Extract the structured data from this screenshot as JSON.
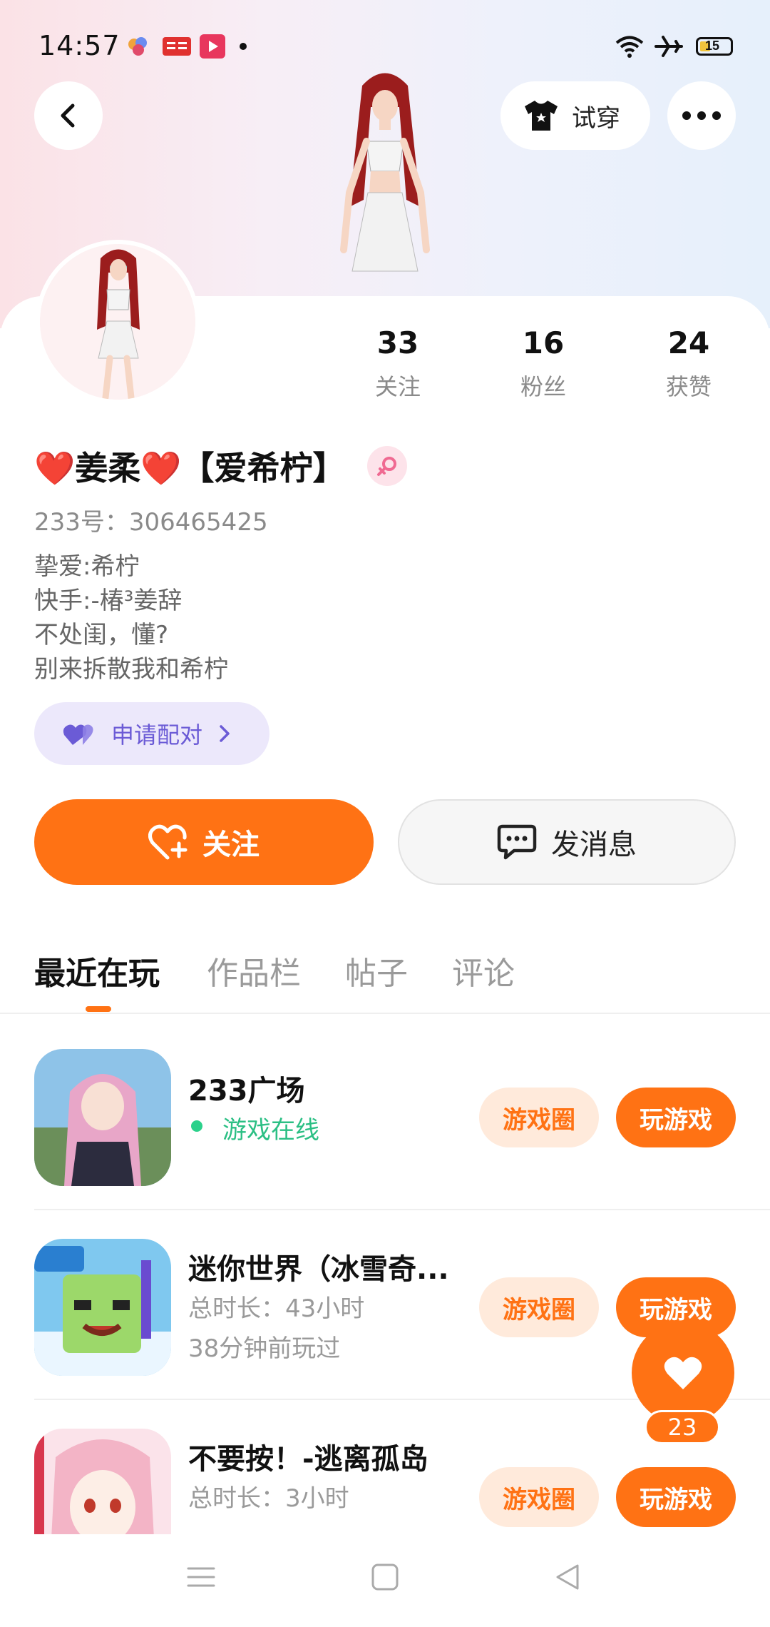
{
  "status_bar": {
    "time": "14:57",
    "battery_level": "15",
    "notification_icons": [
      "app-icon-colorful",
      "toutiao-icon",
      "video-play-icon",
      "dot"
    ],
    "right_icons": [
      "wifi-icon",
      "airplane-mode-icon",
      "battery-icon"
    ]
  },
  "header": {
    "back_icon": "chevron-left-icon",
    "tryon_label": "试穿",
    "more_icon": "more-dots-icon"
  },
  "stats": [
    {
      "value": "33",
      "label": "关注"
    },
    {
      "value": "16",
      "label": "粉丝"
    },
    {
      "value": "24",
      "label": "获赞"
    }
  ],
  "profile": {
    "name": "❤️姜柔❤️【爱希柠】",
    "gender": "female",
    "uid": "233号：306465425",
    "bio": [
      "挚爱:希柠",
      "快手:-椿³姜辞",
      "不处闺，懂?",
      "别来拆散我和希柠"
    ],
    "pair_label": "申请配对"
  },
  "actions": {
    "follow_label": "关注",
    "message_label": "发消息"
  },
  "tabs": [
    "最近在玩",
    "作品栏",
    "帖子",
    "评论"
  ],
  "active_tab": 0,
  "games": [
    {
      "title": "233广场",
      "status": "游戏在线",
      "circle_label": "游戏圈",
      "play_label": "玩游戏"
    },
    {
      "title": "迷你世界（冰雪奇...",
      "duration": "总时长：43小时",
      "last_played": "38分钟前玩过",
      "circle_label": "游戏圈",
      "play_label": "玩游戏"
    },
    {
      "title": "不要按！-逃离孤岛",
      "duration": "总时长：3小时",
      "last_played": "",
      "circle_label": "游戏圈",
      "play_label": "玩游戏"
    }
  ],
  "like_fab": {
    "count": "23"
  },
  "colors": {
    "accent": "#ff7214",
    "accent_light": "#ffeadb",
    "pair_bg": "#ece8fb",
    "pair_text": "#6b5bd6",
    "online_green": "#2bbf84"
  },
  "nav": [
    "menu-icon",
    "home-square-icon",
    "back-triangle-icon"
  ]
}
